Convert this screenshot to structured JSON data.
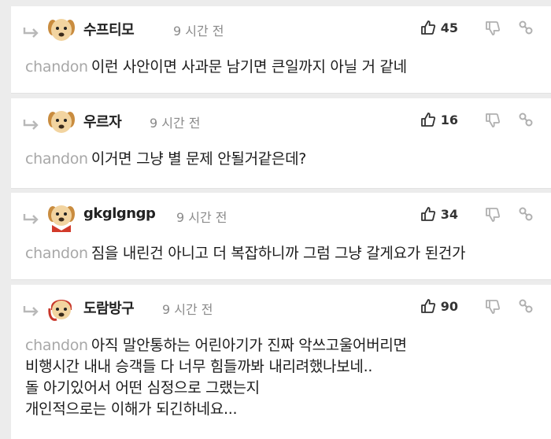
{
  "comments": [
    {
      "nick": "수프티모",
      "time": "9 시간 전",
      "likes": "45",
      "mention": "chandon",
      "lines": [
        "이런 사안이면 사과문 남기면 큰일까지 아닐 거 같네"
      ]
    },
    {
      "nick": "우르자",
      "time": "9 시간 전",
      "likes": "16",
      "mention": "chandon",
      "lines": [
        "이거면 그냥 별 문제 안될거같은데?"
      ]
    },
    {
      "nick": "gkglgngp",
      "time": "9 시간 전",
      "likes": "34",
      "mention": "chandon",
      "lines": [
        "짐을 내린건 아니고 더 복잡하니까 그럼 그냥 갈게요가 된건가"
      ]
    },
    {
      "nick": "도람방구",
      "time": "9 시간 전",
      "likes": "90",
      "mention": "chandon",
      "lines": [
        "아직 말안통하는 어린아기가 진짜 악쓰고울어버리면",
        "비행시간 내내 승객들 다 너무 힘들까봐 내리려했나보네..",
        "돌 아기있어서 어떤 심정으로 그랬는지",
        "개인적으로는 이해가 되긴하네요..."
      ]
    }
  ],
  "icons": {
    "reply": "reply-arrow-icon",
    "avatar": "puppy-avatar-icon",
    "like": "thumbs-up-icon",
    "dislike": "thumbs-down-icon",
    "share": "link-icon"
  },
  "colors": {
    "background": "#ececec",
    "card": "#ffffff",
    "mention": "#a8a8a8",
    "time": "#8a8a8a"
  }
}
